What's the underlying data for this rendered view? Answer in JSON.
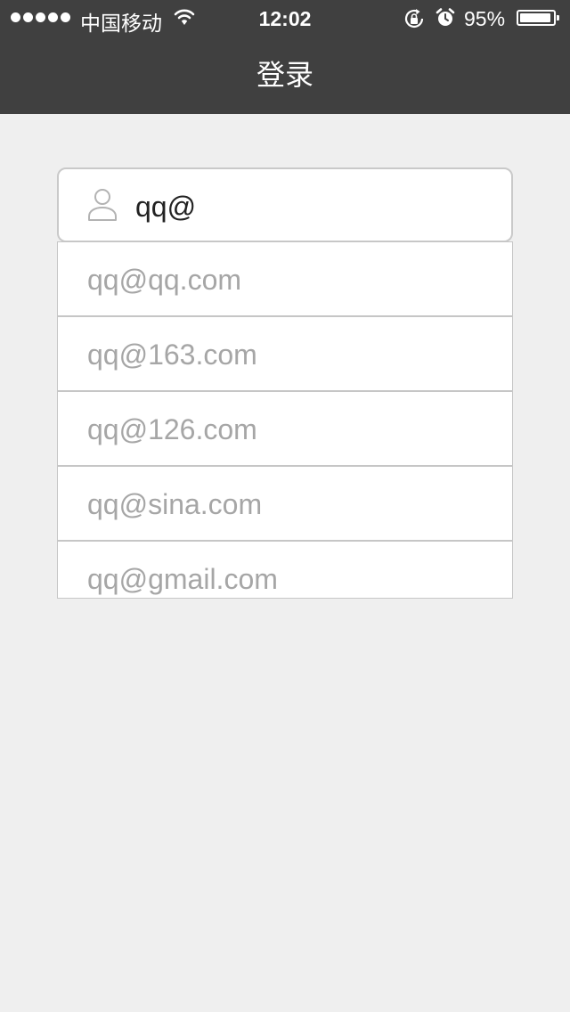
{
  "status_bar": {
    "carrier": "中国移动",
    "time": "12:02",
    "battery_percent": "95%",
    "battery_level": 0.95,
    "signal_bars": 5,
    "icons": [
      "wifi-icon",
      "rotation-lock-icon",
      "alarm-icon",
      "battery-icon"
    ]
  },
  "nav": {
    "title": "登录"
  },
  "login": {
    "username_value": "qq@",
    "username_icon": "user-icon"
  },
  "suggestions": [
    {
      "label": "qq@qq.com"
    },
    {
      "label": "qq@163.com"
    },
    {
      "label": "qq@126.com"
    },
    {
      "label": "qq@sina.com"
    },
    {
      "label": "qq@gmail.com"
    }
  ],
  "colors": {
    "nav_background": "#404040",
    "page_background": "#efefef",
    "suggestion_text": "#a6a6a6",
    "border": "#c6c6c6"
  }
}
